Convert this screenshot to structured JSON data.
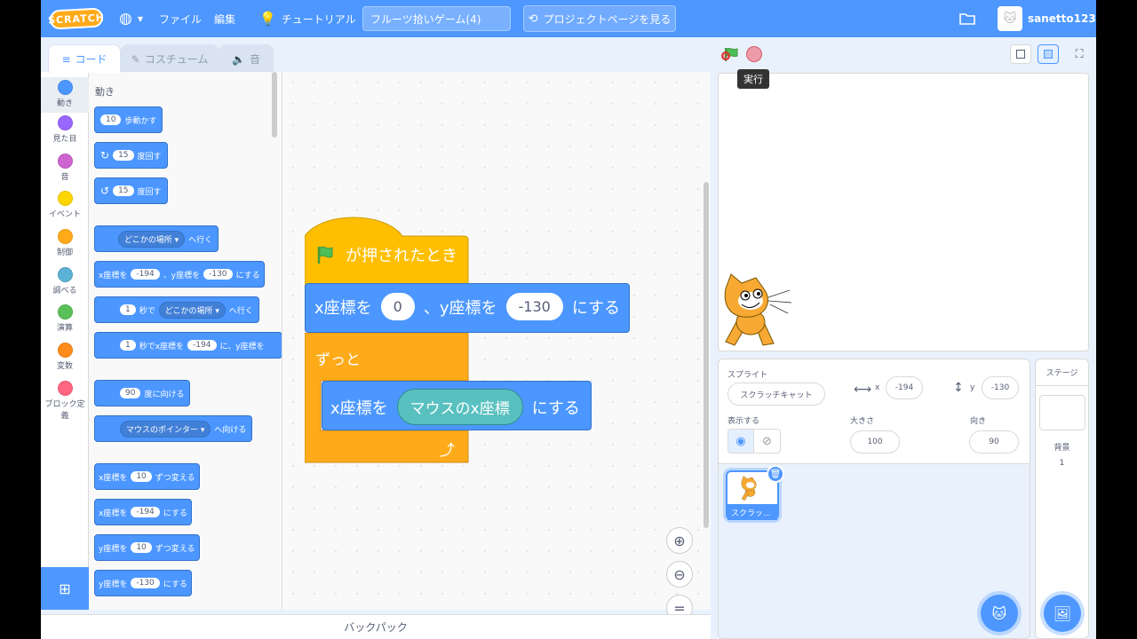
{
  "menubar": {
    "logo": "SCRATCH",
    "file": "ファイル",
    "edit": "編集",
    "tutorials": "チュートリアル",
    "project_title": "フルーツ拾いゲーム(4)",
    "project_page": "プロジェクトページを見る",
    "username": "sanetto123"
  },
  "tabs": [
    "コード",
    "コスチューム",
    "音"
  ],
  "categories": [
    {
      "label": "動き",
      "color": "#4c97ff"
    },
    {
      "label": "見た目",
      "color": "#9966ff"
    },
    {
      "label": "音",
      "color": "#cf63cf"
    },
    {
      "label": "イベント",
      "color": "#ffd500"
    },
    {
      "label": "制御",
      "color": "#ffab19"
    },
    {
      "label": "調べる",
      "color": "#5cb1d6"
    },
    {
      "label": "演算",
      "color": "#59c059"
    },
    {
      "label": "変数",
      "color": "#ff8c1a"
    },
    {
      "label": "ブロック定義",
      "color": "#ff6680"
    }
  ],
  "palette": {
    "title": "動き",
    "b1": {
      "v": "10",
      "t": "歩動かす"
    },
    "b2": {
      "v": "15",
      "t": "度回す"
    },
    "b3": {
      "v": "15",
      "t": "度回す"
    },
    "b4": {
      "dd": "どこかの場所",
      "t": "へ行く"
    },
    "b5": {
      "a": "x座標を",
      "x": "-194",
      "b": "、y座標を",
      "y": "-130",
      "c": "にする"
    },
    "b6": {
      "v": "1",
      "a": "秒で",
      "dd": "どこかの場所",
      "t": "へ行く"
    },
    "b7": {
      "v": "1",
      "a": "秒でx座標を",
      "x": "-194",
      "b": "に、y座標を"
    },
    "b8": {
      "v": "90",
      "t": "度に向ける"
    },
    "b9": {
      "dd": "マウスのポインター",
      "t": "へ向ける"
    },
    "b10": {
      "a": "x座標を",
      "v": "10",
      "t": "ずつ変える"
    },
    "b11": {
      "a": "x座標を",
      "v": "-194",
      "t": "にする"
    },
    "b12": {
      "a": "y座標を",
      "v": "10",
      "t": "ずつ変える"
    },
    "b13": {
      "a": "y座標を",
      "v": "-130",
      "t": "にする"
    }
  },
  "script": {
    "hat": "が押されたとき",
    "goto": {
      "a": "x座標を",
      "x": "0",
      "b": "、y座標を",
      "y": "-130",
      "c": "にする"
    },
    "forever": "ずっと",
    "setx": {
      "a": "x座標を",
      "reporter": "マウスのx座標",
      "c": "にする"
    }
  },
  "backpack": "バックパック",
  "stage": {
    "tooltip": "実行"
  },
  "sprite_info": {
    "sprite_label": "スプライト",
    "sprite_name": "スクラッチキャット",
    "x_label": "x",
    "x": "-194",
    "y_label": "y",
    "y": "-130",
    "show_label": "表示する",
    "size_label": "大きさ",
    "size": "100",
    "direction_label": "向き",
    "direction": "90"
  },
  "sprite_list": [
    {
      "name": "スクラッ..."
    }
  ],
  "stage_pane": {
    "title": "ステージ",
    "backdrop_label": "背景",
    "backdrop_count": "1"
  }
}
